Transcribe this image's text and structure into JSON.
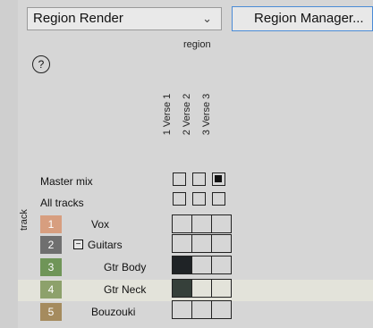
{
  "select": {
    "value": "Region Render",
    "chevron_icon": "chevron-down-icon"
  },
  "manager_button": {
    "label": "Region Manager..."
  },
  "help_label": "?",
  "matrix": {
    "title": "region",
    "regions": [
      {
        "label": "1  Verse 1"
      },
      {
        "label": "2  Verse 2"
      },
      {
        "label": "3  Verse 3"
      }
    ],
    "master_label": "Master mix",
    "all_label": "All tracks",
    "track_axis_label": "track",
    "master_checks": [
      false,
      false,
      true
    ],
    "all_checks": [
      false,
      false,
      false
    ],
    "tracks": [
      {
        "num": "1",
        "name": "Vox",
        "color": "#d79e7f",
        "cells": [
          false,
          false,
          false
        ]
      },
      {
        "num": "2",
        "name": "Guitars",
        "color": "#6f6f6f",
        "folder": true,
        "toggle": "−",
        "cells": [
          false,
          false,
          false
        ]
      },
      {
        "num": "3",
        "name": "Gtr Body",
        "color": "#6f9558",
        "cells": [
          true,
          false,
          false
        ]
      },
      {
        "num": "4",
        "name": "Gtr Neck",
        "color": "#8da16b",
        "cells": [
          true,
          false,
          false
        ]
      },
      {
        "num": "5",
        "name": "Bouzouki",
        "color": "#a58b5e",
        "cells": [
          false,
          false,
          false
        ]
      }
    ]
  }
}
